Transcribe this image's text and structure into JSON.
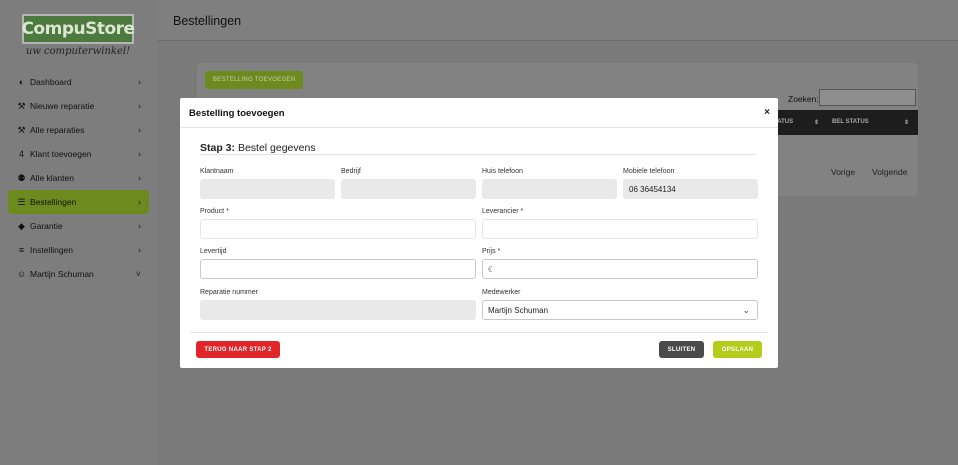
{
  "brand": {
    "name": "CompuStore",
    "tagline": "uw computerwinkel!"
  },
  "sidebar": {
    "items": [
      {
        "label": "Dashboard",
        "icon": "palette-icon",
        "glyph": "◐",
        "chev": "›"
      },
      {
        "label": "Nieuwe reparatie",
        "icon": "wrench-icon",
        "glyph": "⚒",
        "chev": "›"
      },
      {
        "label": "Alle reparaties",
        "icon": "tools-icon",
        "glyph": "⚒",
        "chev": "›"
      },
      {
        "label": "Klant toevoegen",
        "icon": "person-icon",
        "glyph": "὆4",
        "chev": "›"
      },
      {
        "label": "Alle klanten",
        "icon": "users-icon",
        "glyph": "⚉",
        "chev": "›"
      },
      {
        "label": "Bestellingen",
        "icon": "cart-icon",
        "glyph": "☰",
        "chev": "›",
        "active": true
      },
      {
        "label": "Garantie",
        "icon": "shield-icon",
        "glyph": "◆",
        "chev": "›"
      },
      {
        "label": "Instellingen",
        "icon": "sliders-icon",
        "glyph": "≡",
        "chev": "›"
      },
      {
        "label": "Martijn Schuman",
        "icon": "user-icon",
        "glyph": "☺",
        "chev": "˅"
      }
    ]
  },
  "header": {
    "title": "Bestellingen"
  },
  "background": {
    "add_button": "BESTELLING TOEVOEGEN",
    "search_label": "Zoeken:",
    "columns": [
      "TATUS",
      "BEL STATUS"
    ],
    "pager": {
      "prev": "Vorige",
      "next": "Volgende"
    }
  },
  "modal": {
    "title": "Bestelling toevoegen",
    "close": "×",
    "step_label": "Stap 3:",
    "step_title": "Bestel gegevens",
    "fields": {
      "klantnaam": {
        "label": "Klantnaam",
        "value": ""
      },
      "bedrijf": {
        "label": "Bedrijf",
        "value": ""
      },
      "huis_telefoon": {
        "label": "Huis telefoon",
        "value": ""
      },
      "mobiele_telefoon": {
        "label": "Mobiele telefoon",
        "value": "06 36454134"
      },
      "product": {
        "label": "Product *",
        "value": ""
      },
      "leverancier": {
        "label": "Leverancier *",
        "value": ""
      },
      "levertijd": {
        "label": "Levertijd",
        "value": ""
      },
      "prijs": {
        "label": "Prijs *",
        "placeholder": "€",
        "value": ""
      },
      "reparatie_nummer": {
        "label": "Reparatie nummer",
        "value": ""
      },
      "medewerker": {
        "label": "Medewerker",
        "value": "Martijn Schuman"
      }
    },
    "buttons": {
      "back": "TERUG NAAR STAP 2",
      "close": "SLUITEN",
      "save": "OPSLAAN"
    }
  },
  "colors": {
    "accent": "#b3cd1a",
    "danger": "#e0262a",
    "dark": "#4a4a4a"
  }
}
